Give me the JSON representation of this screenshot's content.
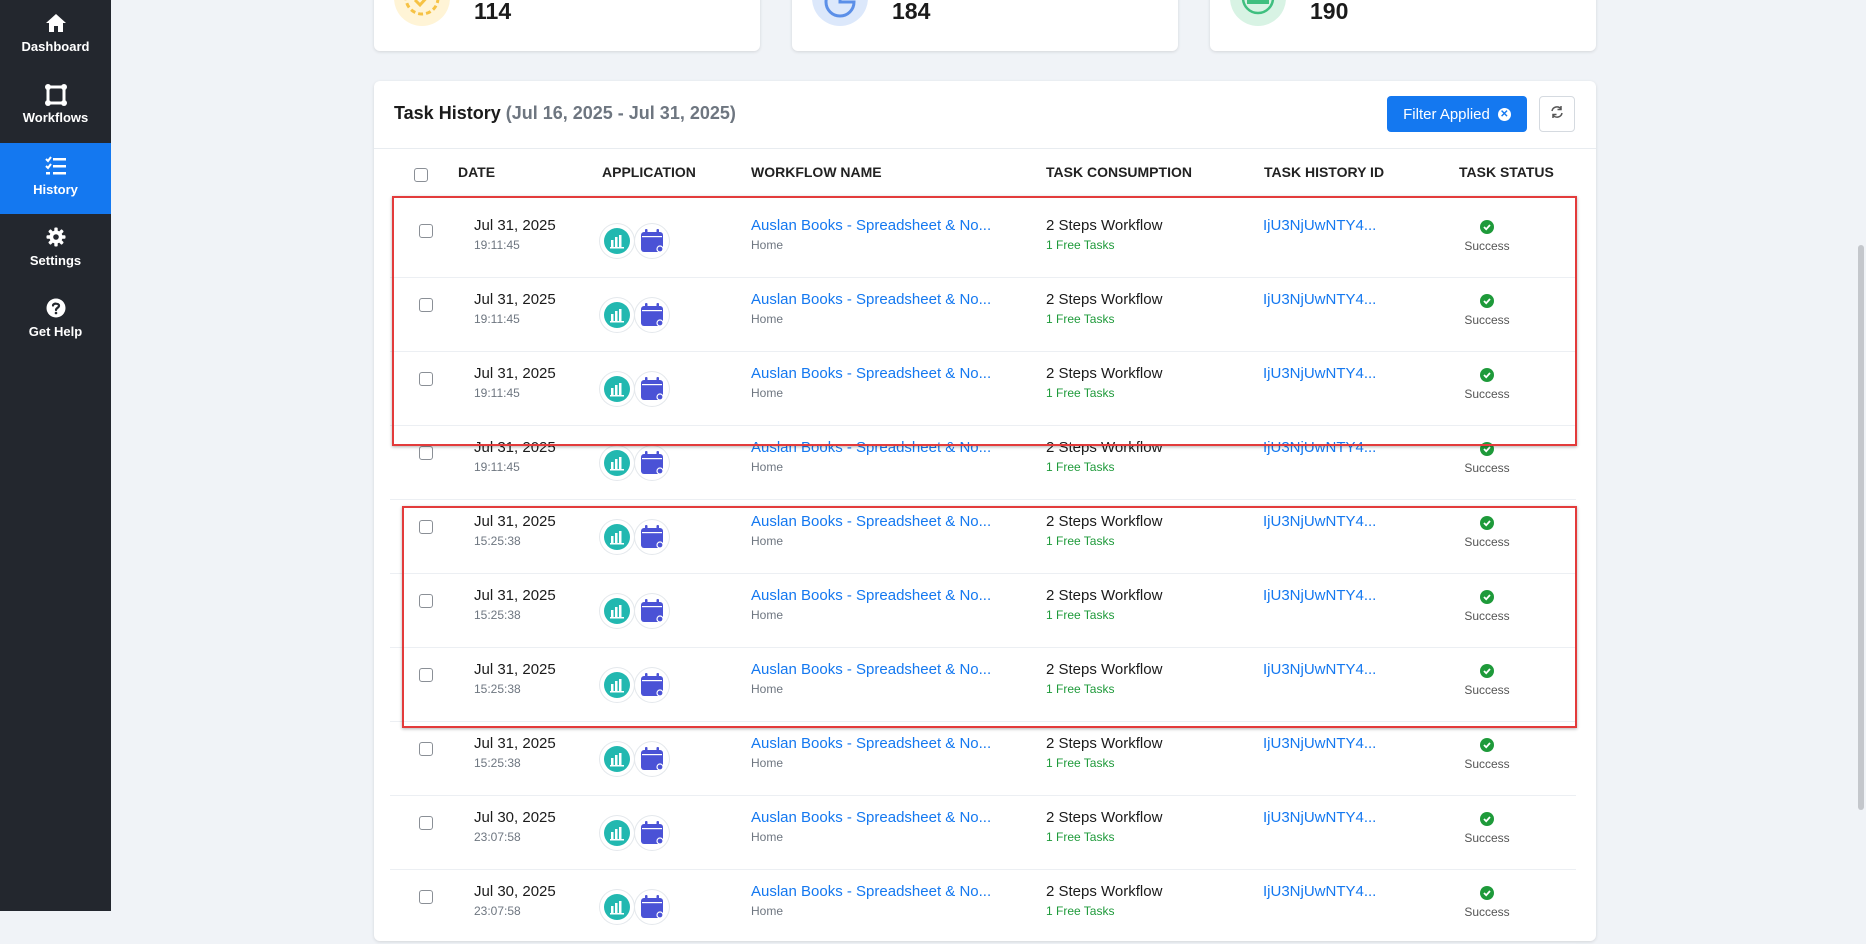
{
  "sidebar": {
    "items": [
      {
        "label": "Dashboard",
        "icon": "home-icon",
        "active": false
      },
      {
        "label": "Workflows",
        "icon": "workflow-icon",
        "active": false
      },
      {
        "label": "History",
        "icon": "history-list-icon",
        "active": true
      },
      {
        "label": "Settings",
        "icon": "gear-icon",
        "active": false
      },
      {
        "label": "Get Help",
        "icon": "help-icon",
        "active": false
      }
    ]
  },
  "stats": [
    {
      "value": "114",
      "icon": "badge-check-icon",
      "color": "#f6c244"
    },
    {
      "value": "184",
      "icon": "pie-chart-icon",
      "color": "#7da8f0"
    },
    {
      "value": "190",
      "icon": "free-badge-icon",
      "color": "#5cc98f"
    }
  ],
  "task_history": {
    "title": "Task History",
    "range": "(Jul 16, 2025 - Jul 31, 2025)",
    "filter_label": "Filter Applied",
    "columns": [
      "DATE",
      "APPLICATION",
      "WORKFLOW NAME",
      "TASK CONSUMPTION",
      "TASK HISTORY ID",
      "TASK STATUS"
    ],
    "rows": [
      {
        "date": "Jul 31, 2025",
        "time": "19:11:45",
        "workflow": "Auslan Books - Spreadsheet & No...",
        "workflow_sub": "Home",
        "consumption": "2 Steps Workflow",
        "consumption_sub": "1 Free Tasks",
        "history_id": "IjU3NjUwNTY4...",
        "status": "Success"
      },
      {
        "date": "Jul 31, 2025",
        "time": "19:11:45",
        "workflow": "Auslan Books - Spreadsheet & No...",
        "workflow_sub": "Home",
        "consumption": "2 Steps Workflow",
        "consumption_sub": "1 Free Tasks",
        "history_id": "IjU3NjUwNTY4...",
        "status": "Success"
      },
      {
        "date": "Jul 31, 2025",
        "time": "19:11:45",
        "workflow": "Auslan Books - Spreadsheet & No...",
        "workflow_sub": "Home",
        "consumption": "2 Steps Workflow",
        "consumption_sub": "1 Free Tasks",
        "history_id": "IjU3NjUwNTY4...",
        "status": "Success"
      },
      {
        "date": "Jul 31, 2025",
        "time": "19:11:45",
        "workflow": "Auslan Books - Spreadsheet & No...",
        "workflow_sub": "Home",
        "consumption": "2 Steps Workflow",
        "consumption_sub": "1 Free Tasks",
        "history_id": "IjU3NjUwNTY4...",
        "status": "Success"
      },
      {
        "date": "Jul 31, 2025",
        "time": "15:25:38",
        "workflow": "Auslan Books - Spreadsheet & No...",
        "workflow_sub": "Home",
        "consumption": "2 Steps Workflow",
        "consumption_sub": "1 Free Tasks",
        "history_id": "IjU3NjUwNTY4...",
        "status": "Success"
      },
      {
        "date": "Jul 31, 2025",
        "time": "15:25:38",
        "workflow": "Auslan Books - Spreadsheet & No...",
        "workflow_sub": "Home",
        "consumption": "2 Steps Workflow",
        "consumption_sub": "1 Free Tasks",
        "history_id": "IjU3NjUwNTY4...",
        "status": "Success"
      },
      {
        "date": "Jul 31, 2025",
        "time": "15:25:38",
        "workflow": "Auslan Books - Spreadsheet & No...",
        "workflow_sub": "Home",
        "consumption": "2 Steps Workflow",
        "consumption_sub": "1 Free Tasks",
        "history_id": "IjU3NjUwNTY4...",
        "status": "Success"
      },
      {
        "date": "Jul 31, 2025",
        "time": "15:25:38",
        "workflow": "Auslan Books - Spreadsheet & No...",
        "workflow_sub": "Home",
        "consumption": "2 Steps Workflow",
        "consumption_sub": "1 Free Tasks",
        "history_id": "IjU3NjUwNTY4...",
        "status": "Success"
      },
      {
        "date": "Jul 30, 2025",
        "time": "23:07:58",
        "workflow": "Auslan Books - Spreadsheet & No...",
        "workflow_sub": "Home",
        "consumption": "2 Steps Workflow",
        "consumption_sub": "1 Free Tasks",
        "history_id": "IjU3NjUwNTY4...",
        "status": "Success"
      },
      {
        "date": "Jul 30, 2025",
        "time": "23:07:58",
        "workflow": "Auslan Books - Spreadsheet & No...",
        "workflow_sub": "Home",
        "consumption": "2 Steps Workflow",
        "consumption_sub": "1 Free Tasks",
        "history_id": "IjU3NjUwNTY4...",
        "status": "Success"
      }
    ]
  },
  "colors": {
    "sidebar_bg": "#23272e",
    "accent": "#1478f0",
    "success": "#1e9a3a",
    "highlight_border": "#e33b3b",
    "app1": "#22b8b0",
    "app2": "#4a52d6"
  }
}
